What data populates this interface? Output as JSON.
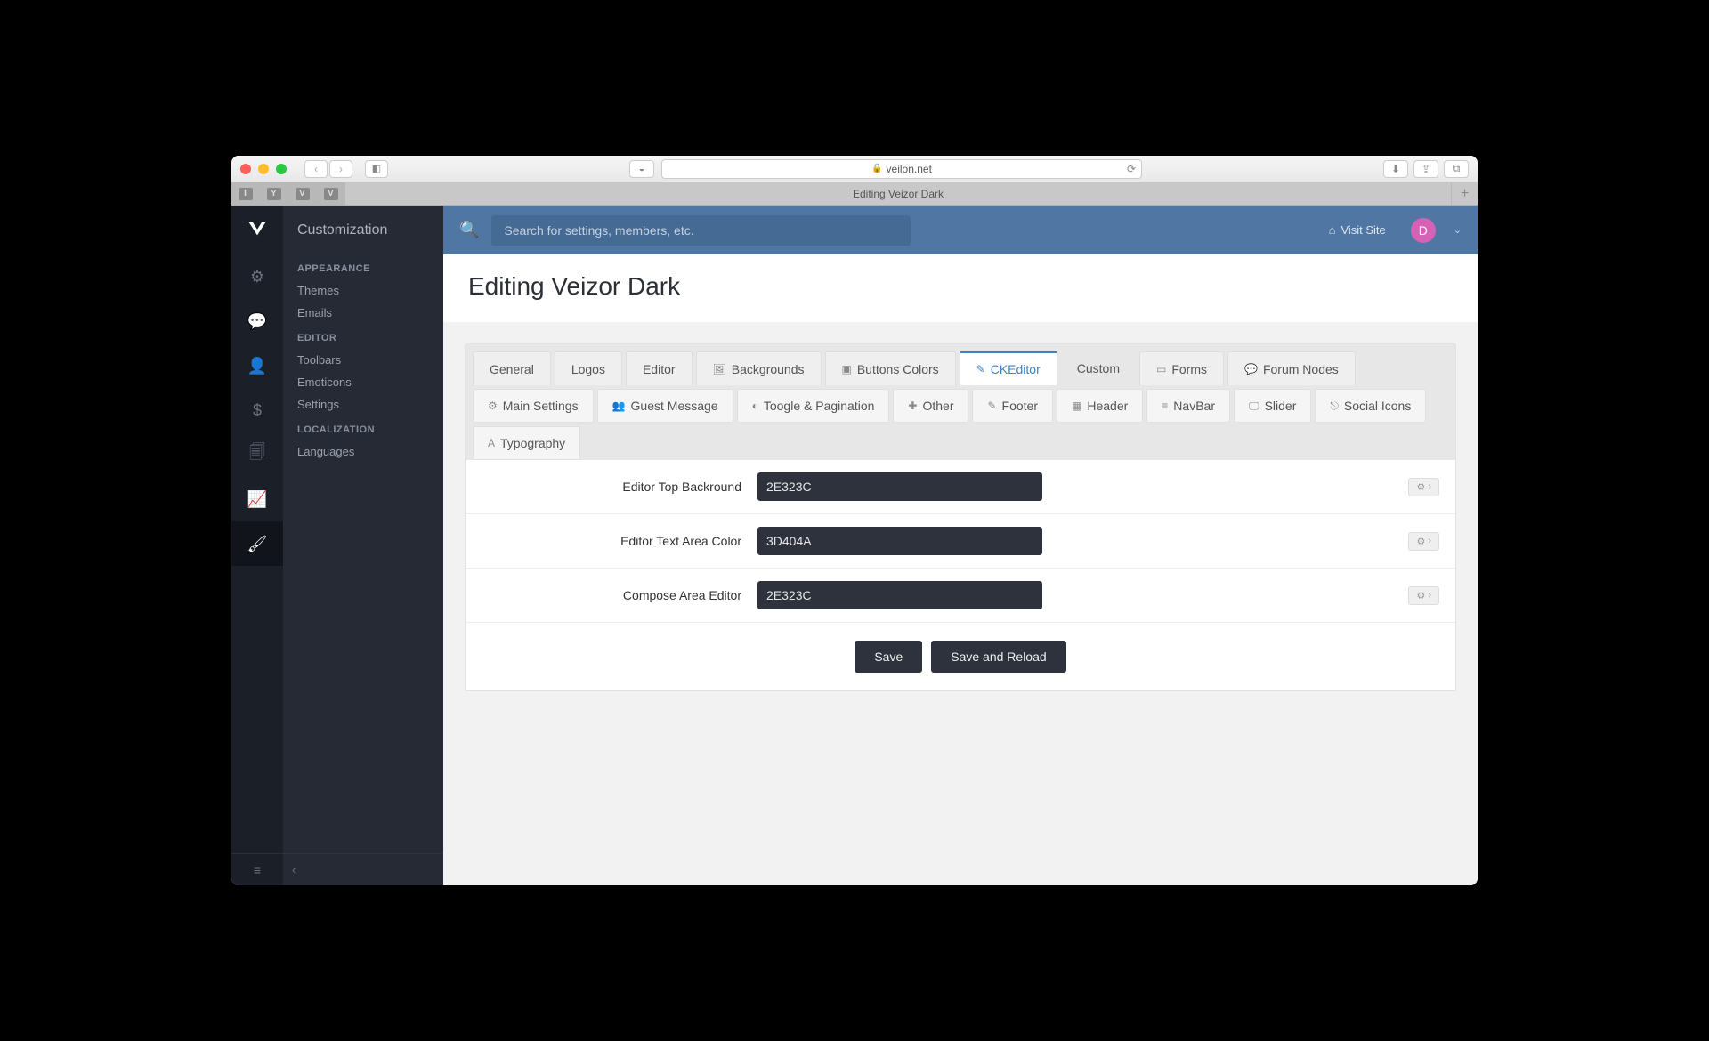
{
  "browser": {
    "url_host": "veilon.net",
    "tab_title": "Editing Veizor Dark",
    "fav_tabs": [
      "I",
      "Y",
      "V",
      "V"
    ]
  },
  "sidebar": {
    "title": "Customization",
    "sections": [
      {
        "label": "APPEARANCE",
        "items": [
          "Themes",
          "Emails"
        ]
      },
      {
        "label": "EDITOR",
        "items": [
          "Toolbars",
          "Emoticons",
          "Settings"
        ]
      },
      {
        "label": "LOCALIZATION",
        "items": [
          "Languages"
        ]
      }
    ]
  },
  "topbar": {
    "search_placeholder": "Search for settings, members, etc.",
    "visit_site": "Visit Site",
    "avatar_initial": "D"
  },
  "page": {
    "title": "Editing Veizor Dark"
  },
  "tabs_primary": [
    {
      "label": "General"
    },
    {
      "label": "Logos"
    },
    {
      "label": "Editor"
    },
    {
      "label": "Backgrounds",
      "icon": "image"
    },
    {
      "label": "Buttons Colors",
      "icon": "square"
    },
    {
      "label": "CKEditor",
      "icon": "edit",
      "active": true
    },
    {
      "label": "Custom",
      "plain": true
    },
    {
      "label": "Forms",
      "icon": "card"
    },
    {
      "label": "Forum Nodes",
      "icon": "comments"
    }
  ],
  "tabs_secondary": [
    {
      "label": "Main Settings",
      "icon": "cog"
    },
    {
      "label": "Guest Message",
      "icon": "users"
    },
    {
      "label": "Toogle & Pagination",
      "icon": "toggle"
    },
    {
      "label": "Other",
      "icon": "plus"
    },
    {
      "label": "Footer",
      "icon": "pencil"
    },
    {
      "label": "Header",
      "icon": "grid"
    },
    {
      "label": "NavBar",
      "icon": "bars"
    },
    {
      "label": "Slider",
      "icon": "monitor"
    },
    {
      "label": "Social Icons",
      "icon": "share"
    },
    {
      "label": "Typography",
      "icon": "font"
    }
  ],
  "fields": [
    {
      "label": "Editor Top Backround",
      "value": "2E323C"
    },
    {
      "label": "Editor Text Area Color",
      "value": "3D404A"
    },
    {
      "label": "Compose Area Editor",
      "value": "2E323C"
    }
  ],
  "buttons": {
    "save": "Save",
    "save_reload": "Save and Reload"
  }
}
